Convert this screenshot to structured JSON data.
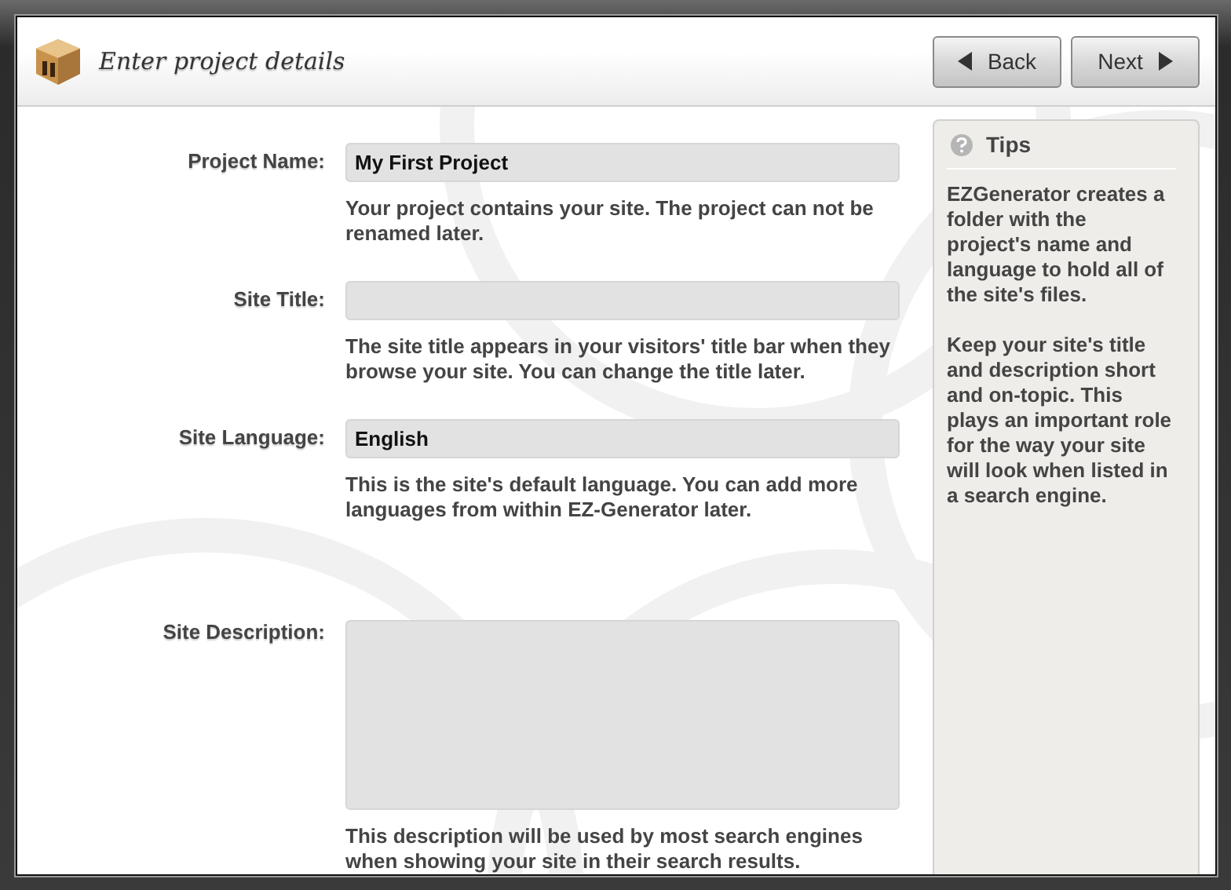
{
  "header": {
    "title": "Enter project details"
  },
  "nav_buttons": [
    {
      "label": "Back",
      "kind": "back"
    },
    {
      "label": "Next",
      "kind": "next"
    }
  ],
  "form": [
    {
      "label": "Project Name:",
      "kind": "text",
      "value": "My First Project",
      "help": "Your project contains your site. The project can not be renamed later."
    },
    {
      "label": "Site Title:",
      "kind": "text",
      "help": "The site title appears in your visitors' title bar when they browse your site. You can change the title later."
    },
    {
      "label": "Site Language:",
      "kind": "text",
      "value": "English",
      "help": "This is the site's default language. You can add more languages from within EZ-Generator later."
    },
    {
      "label": "Site Description:",
      "kind": "textarea",
      "help": "This description will be used by most search engines when showing your site in their search results."
    }
  ],
  "tips": {
    "title": "Tips",
    "paragraphs": [
      "EZGenerator creates a folder with the project's name and language to hold all of the site's files.",
      "Keep your site's title and description short and on-topic. This plays an important role for the way your site will look when listed in a search engine."
    ]
  }
}
